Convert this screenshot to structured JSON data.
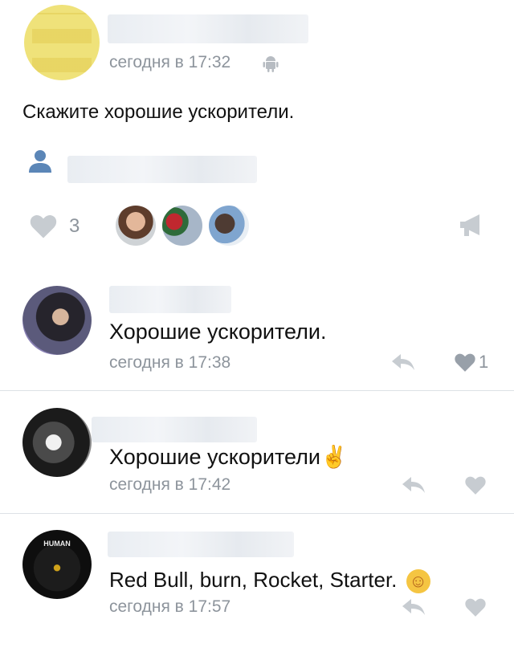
{
  "post": {
    "time": "сегодня в 17:32",
    "text": "Скажите хорошие ускорители.",
    "likes_count": "3"
  },
  "comments": [
    {
      "text": "Хорошие ускорители.",
      "time": "сегодня в 17:38",
      "likes": "1"
    },
    {
      "text": "Хорошие ускорители",
      "emoji": "✌",
      "time": "сегодня в 17:42",
      "likes": ""
    },
    {
      "text": "Red Bull, burn, Rocket, Starter.",
      "emoji": "☺",
      "time": "сегодня в 17:57",
      "likes": "",
      "avatar_caption": "HUMAN"
    }
  ],
  "colors": {
    "icon_grey": "#c7ccd1",
    "time_grey": "#8d949c",
    "user_icon": "#5b86b7"
  },
  "icons": [
    "android-icon",
    "user-icon",
    "heart-icon",
    "reply-icon",
    "share-megaphone-icon"
  ]
}
